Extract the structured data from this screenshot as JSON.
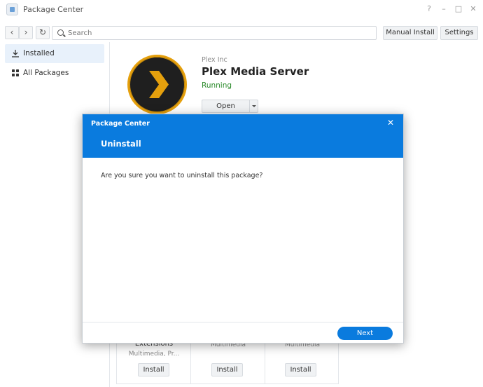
{
  "window": {
    "title": "Package Center",
    "controls": {
      "help": "?",
      "minimize": "–",
      "maximize": "□",
      "close": "✕"
    }
  },
  "toolbar": {
    "back": "‹",
    "forward": "›",
    "refresh": "↻",
    "search_placeholder": "Search",
    "manual_install_label": "Manual Install",
    "settings_label": "Settings"
  },
  "sidebar": {
    "items": [
      {
        "label": "Installed",
        "icon": "download-icon",
        "active": true
      },
      {
        "label": "All Packages",
        "icon": "grid-icon",
        "active": false
      }
    ]
  },
  "package": {
    "publisher": "Plex Inc",
    "name": "Plex Media Server",
    "status": "Running",
    "open_label": "Open",
    "logo": "plex-chevron-icon",
    "status_color": "#2a8a2a"
  },
  "cards": [
    {
      "title": "Extensions",
      "category": "Multimedia, Pr...",
      "button": "Install"
    },
    {
      "title": "",
      "category": "Multimedia",
      "button": "Install"
    },
    {
      "title": "",
      "category": "Multimedia",
      "button": "Install"
    }
  ],
  "modal": {
    "app_name": "Package Center",
    "title": "Uninstall",
    "close": "✕",
    "message": "Are you sure you want to uninstall this package?",
    "next_label": "Next",
    "accent_color": "#0a7bde"
  }
}
